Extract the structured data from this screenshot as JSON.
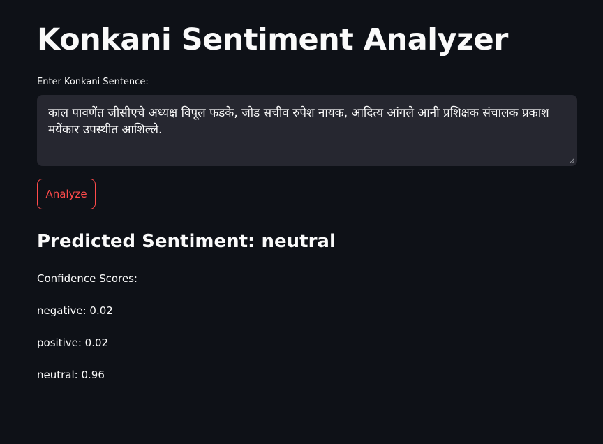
{
  "app": {
    "title": "Konkani Sentiment Analyzer"
  },
  "input": {
    "label": "Enter Konkani Sentence:",
    "value": "काल पावणेंत जीसीएचे अध्यक्ष विपूल फडके, जोड सचीव रुपेश नायक, आदित्य आंगले आनी प्रशिक्षक संचालक प्रकाश मयेंकार उपस्थीत आशिल्ले."
  },
  "actions": {
    "analyze_label": "Analyze"
  },
  "result": {
    "heading": "Predicted Sentiment: neutral",
    "confidence_label": "Confidence Scores:",
    "scores": [
      "negative: 0.02",
      "positive: 0.02",
      "neutral: 0.96"
    ]
  },
  "colors": {
    "background": "#0e1117",
    "input_background": "#262730",
    "accent": "#ff4b4b",
    "text": "#fafafa"
  }
}
